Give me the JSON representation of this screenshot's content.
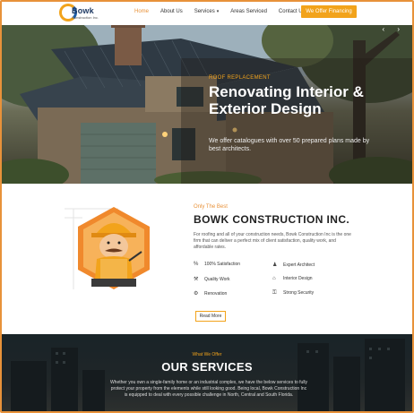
{
  "header": {
    "logo_name": "Bowk",
    "logo_sub": "Construction Inc.",
    "nav": [
      {
        "label": "Home",
        "active": true
      },
      {
        "label": "About Us",
        "active": false
      },
      {
        "label": "Services",
        "active": false,
        "has_dropdown": true
      },
      {
        "label": "Areas Serviced",
        "active": false
      },
      {
        "label": "Contact Us",
        "active": false
      }
    ],
    "cta_label": "We Offer Financing"
  },
  "hero": {
    "arrows": "‹ ›",
    "tag": "ROOF REPLACEMENT",
    "title": "Renovating Interior & Exterior Design",
    "description": "We offer catalogues with over 50 prepared plans made by best architects."
  },
  "about": {
    "kicker": "Only The Best",
    "title": "BOWK CONSTRUCTION INC.",
    "body": "For roofing and all of your construction needs, Bowk Construction Inc is the one firm that can deliver a perfect mix of client satisfaction, quality work, and affordable rates.",
    "features": [
      {
        "label": "100% Satisfaction",
        "icon": "percent-icon"
      },
      {
        "label": "Expert Architect",
        "icon": "architect-icon"
      },
      {
        "label": "Quality Work",
        "icon": "quality-icon"
      },
      {
        "label": "Interior Design",
        "icon": "interior-icon"
      },
      {
        "label": "Renovation",
        "icon": "renovation-icon"
      },
      {
        "label": "Strong Security",
        "icon": "security-icon"
      }
    ],
    "read_more": "Read More"
  },
  "services": {
    "kicker": "What We Offer",
    "title": "OUR SERVICES",
    "description": "Whether you own a single-family home or an industrial complex, we have the below services to fully protect your property from the elements while still looking good. Being local, Bowk Construction Inc is equipped to deal with every possible challenge in North, Central and South Florida."
  },
  "colors": {
    "accent": "#f2a31b",
    "nav_active": "#e8923a",
    "frame_border": "#e8923a",
    "brand_blue": "#1f3a63"
  }
}
